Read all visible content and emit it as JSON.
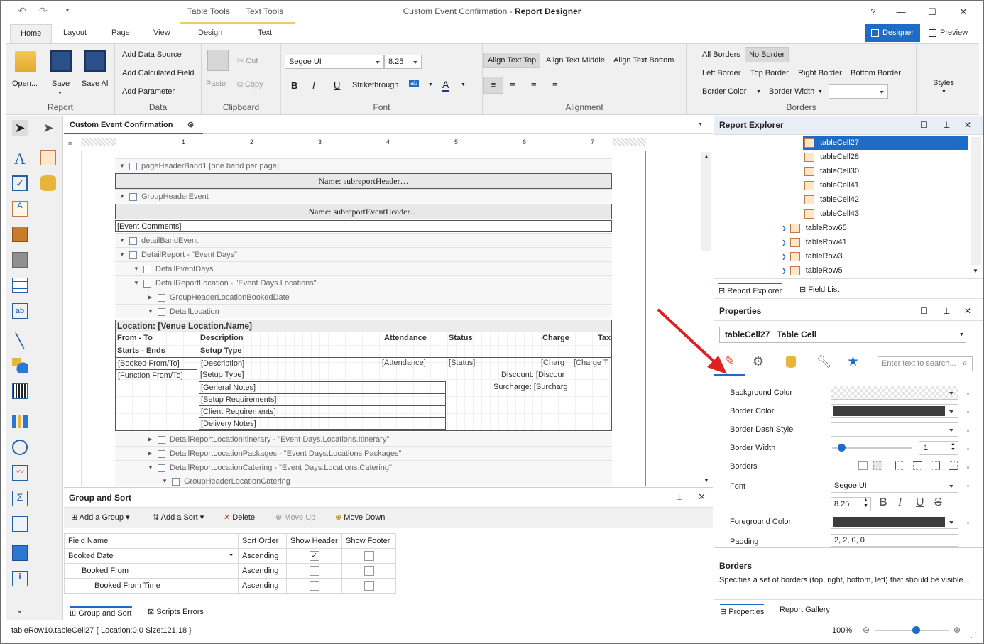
{
  "window": {
    "title_prefix": "Custom Event Confirmation",
    "title_sep": " - ",
    "title_app": "Report Designer",
    "ctx_table": "Table Tools",
    "ctx_text": "Text Tools"
  },
  "tabs": [
    "Home",
    "Layout",
    "Page",
    "View",
    "Design",
    "Text"
  ],
  "modes": {
    "designer": "Designer",
    "preview": "Preview"
  },
  "ribbon": {
    "report": {
      "label": "Report",
      "open": "Open...",
      "save": "Save",
      "save_all": "Save All"
    },
    "data": {
      "label": "Data",
      "add_source": "Add Data Source",
      "add_calc": "Add Calculated Field",
      "add_param": "Add Parameter"
    },
    "clipboard": {
      "label": "Clipboard",
      "paste": "Paste",
      "cut": "Cut",
      "copy": "Copy"
    },
    "font": {
      "label": "Font",
      "family": "Segoe UI",
      "size": "8.25",
      "bold": "B",
      "italic": "I",
      "underline": "U",
      "strike": "Strikethrough",
      "ab": "ab",
      "a": "A"
    },
    "alignment": {
      "label": "Alignment",
      "top": "Align Text Top",
      "middle": "Align Text Middle",
      "bottom": "Align Text Bottom"
    },
    "borders": {
      "label": "Borders",
      "all": "All Borders",
      "none": "No Border",
      "left": "Left Border",
      "top": "Top Border",
      "right": "Right Border",
      "bottom": "Bottom Border",
      "color": "Border Color",
      "width": "Border Width"
    },
    "styles": "Styles"
  },
  "doc_tab": "Custom Event Confirmation",
  "ruler": [
    "1",
    "2",
    "3",
    "4",
    "5",
    "6",
    "7"
  ],
  "bands": {
    "page_header": "pageHeaderBand1 [one band per page]",
    "sub_header": "Name: subreportHeader…",
    "group_header_event": "GroupHeaderEvent",
    "sub_event_header": "Name: subreportEventHeader…",
    "event_comments": "[Event Comments]",
    "detail_band_event": "detailBandEvent",
    "detail_report": "DetailReport - \"Event Days\"",
    "detail_event_days": "DetailEventDays",
    "detail_report_location": "DetailReportLocation - \"Event Days.Locations\"",
    "group_header_booked": "GroupHeaderLocationBookedDate",
    "detail_location": "DetailLocation",
    "itinerary": "DetailReportLocationItinerary - \"Event Days.Locations.Itinerary\"",
    "packages": "DetailReportLocationPackages - \"Event Days.Locations.Packages\"",
    "catering": "DetailReportLocationCatering - \"Event Days.Locations.Catering\"",
    "group_header_catering": "GroupHeaderLocationCatering"
  },
  "table": {
    "location_title": "Location: [Venue Location.Name]",
    "headers": [
      "From - To",
      "Description",
      "Attendance",
      "Status",
      "Charge",
      "Tax"
    ],
    "sub_headers": [
      "Starts - Ends",
      "Setup Type"
    ],
    "booked": "[Booked From/To]",
    "desc": "[Description]",
    "attendance": "[Attendance]",
    "status": "[Status]",
    "charge": "[Charg",
    "charge2": "[Charge T",
    "function": "[Function From/To]",
    "setup": "[Setup Type]",
    "discount": "Discount: [Discour",
    "general": "[General Notes]",
    "surcharge": "Surcharge: [Surcharg",
    "setup_req": "[Setup Requirements]",
    "client_req": "[Client Requirements]",
    "delivery": "[Delivery Notes]"
  },
  "group_sort": {
    "title": "Group and Sort",
    "add_group": "Add a Group",
    "add_sort": "Add a Sort",
    "delete": "Delete",
    "move_up": "Move Up",
    "move_down": "Move Down",
    "columns": [
      "Field Name",
      "Sort Order",
      "Show Header",
      "Show Footer"
    ],
    "rows": [
      {
        "field": "Booked Date",
        "order": "Ascending",
        "header": true,
        "footer": false
      },
      {
        "field": "Booked From",
        "order": "Ascending",
        "header": false,
        "footer": false
      },
      {
        "field": "Booked From Time",
        "order": "Ascending",
        "header": false,
        "footer": false
      }
    ],
    "tab1": "Group and Sort",
    "tab2": "Scripts Errors"
  },
  "explorer": {
    "title": "Report Explorer",
    "cells": [
      "tableCell27",
      "tableCell28",
      "tableCell30",
      "tableCell41",
      "tableCell42",
      "tableCell43"
    ],
    "rows": [
      "tableRow65",
      "tableRow41",
      "tableRow3",
      "tableRow5"
    ],
    "tab1": "Report Explorer",
    "tab2": "Field List"
  },
  "properties": {
    "title": "Properties",
    "selected": "tableCell27   Table Cell",
    "search_placeholder": "Enter text to search...",
    "labels": [
      "Background Color",
      "Border Color",
      "Border Dash Style",
      "Border Width",
      "Borders",
      "Font",
      "Foreground Color",
      "Padding"
    ],
    "border_width": "1",
    "font": "Segoe UI",
    "font_size": "8.25",
    "padding": "2, 2, 0, 0",
    "bold": "B",
    "italic": "I",
    "underline": "U",
    "strike": "S",
    "desc_title": "Borders",
    "desc_text": "Specifies a set of borders (top, right, bottom, left) that should be visible...",
    "tab1": "Properties",
    "tab2": "Report Gallery"
  },
  "status": {
    "text": "tableRow10.tableCell27 { Location:0,0 Size:121,18 }",
    "zoom": "100%",
    "zoom_fraction": 0.55
  },
  "colors": {
    "accent": "#1e6cc6",
    "arrow": "#e02020"
  }
}
